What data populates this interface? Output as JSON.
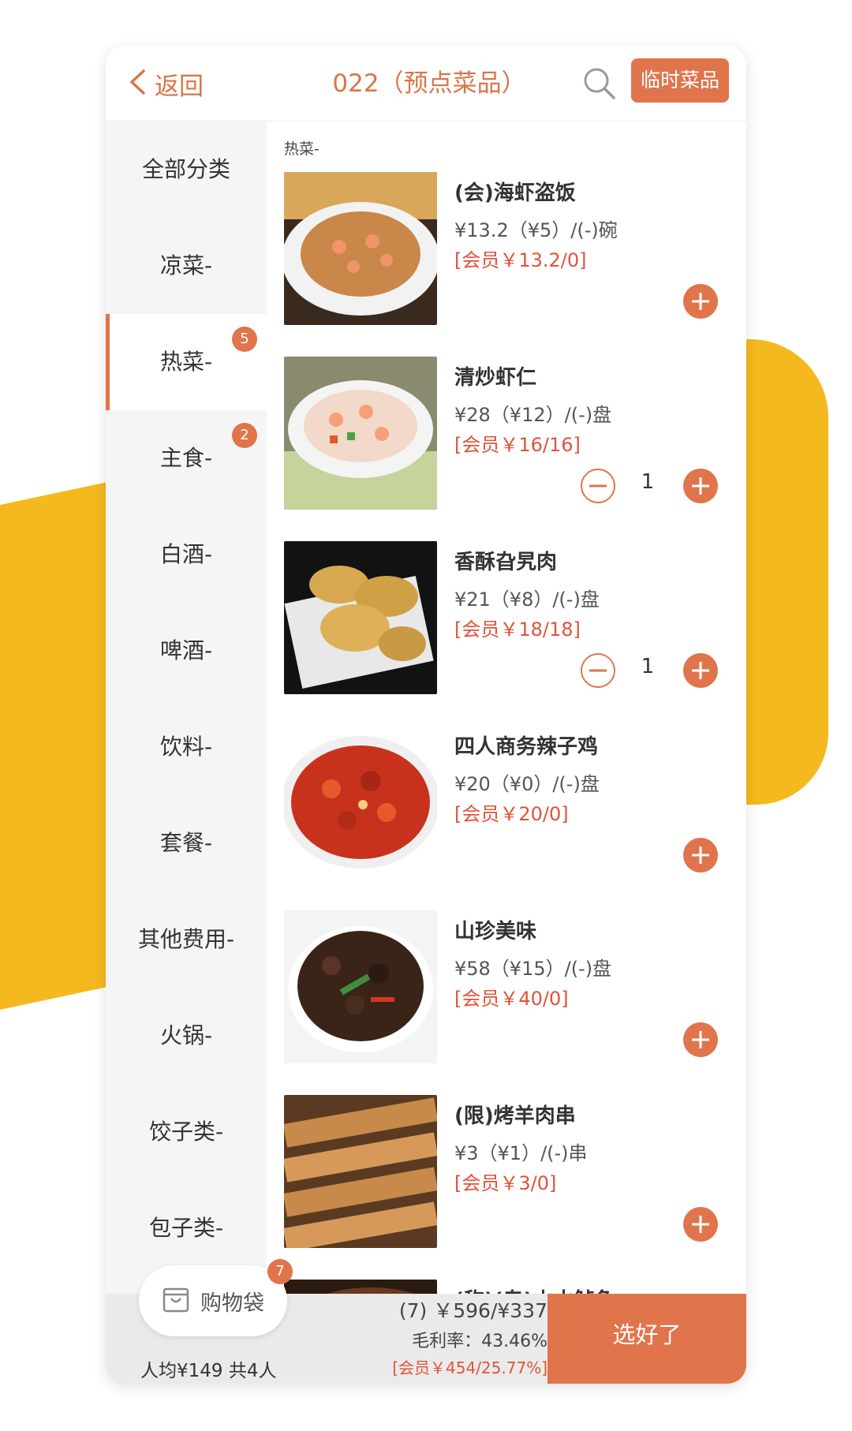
{
  "header": {
    "back_label": "返回",
    "title": "022（预点菜品）",
    "temp_button": "临时菜品"
  },
  "sidebar": {
    "items": [
      {
        "label": "全部分类",
        "badge": null
      },
      {
        "label": "凉菜-",
        "badge": null
      },
      {
        "label": "热菜-",
        "badge": "5",
        "active": true
      },
      {
        "label": "主食-",
        "badge": "2"
      },
      {
        "label": "白酒-",
        "badge": null
      },
      {
        "label": "啤酒-",
        "badge": null
      },
      {
        "label": "饮料-",
        "badge": null
      },
      {
        "label": "套餐-",
        "badge": null
      },
      {
        "label": "其他费用-",
        "badge": null
      },
      {
        "label": "火锅-",
        "badge": null
      },
      {
        "label": "饺子类-",
        "badge": null
      },
      {
        "label": "包子类-",
        "badge": null
      }
    ]
  },
  "content": {
    "section_title": "热菜-",
    "items": [
      {
        "name": "(会)海虾盗饭",
        "price": "¥13.2（¥5）/(-)碗",
        "member": "[会员￥13.2/0]",
        "qty": null
      },
      {
        "name": "清炒虾仁",
        "price": "¥28（¥12）/(-)盘",
        "member": "[会员￥16/16]",
        "qty": "1"
      },
      {
        "name": "香酥旮旯肉",
        "price": "¥21（¥8）/(-)盘",
        "member": "[会员￥18/18]",
        "qty": "1"
      },
      {
        "name": "四人商务辣子鸡",
        "price": "¥20（¥0）/(-)盘",
        "member": "[会员￥20/0]",
        "qty": null
      },
      {
        "name": "山珍美味",
        "price": "¥58（¥15）/(-)盘",
        "member": "[会员￥40/0]",
        "qty": null
      },
      {
        "name": "(限)烤羊肉串",
        "price": "¥3（¥1）/(-)串",
        "member": "[会员￥3/0]",
        "qty": null
      },
      {
        "name": "(称)(专)山水鲈鱼",
        "price": "",
        "member": "",
        "qty": null
      }
    ]
  },
  "bottom": {
    "cart_label": "购物袋",
    "cart_badge": "7",
    "per_person": "人均¥149 共4人",
    "total_line": "(7) ￥596/¥337",
    "margin_line": "毛利率：43.46%",
    "member_line": "[会员￥454/25.77%]",
    "done_button": "选好了"
  },
  "colors": {
    "accent": "#e0744b",
    "member_red": "#e0533a",
    "deco_yellow": "#f5b920"
  }
}
